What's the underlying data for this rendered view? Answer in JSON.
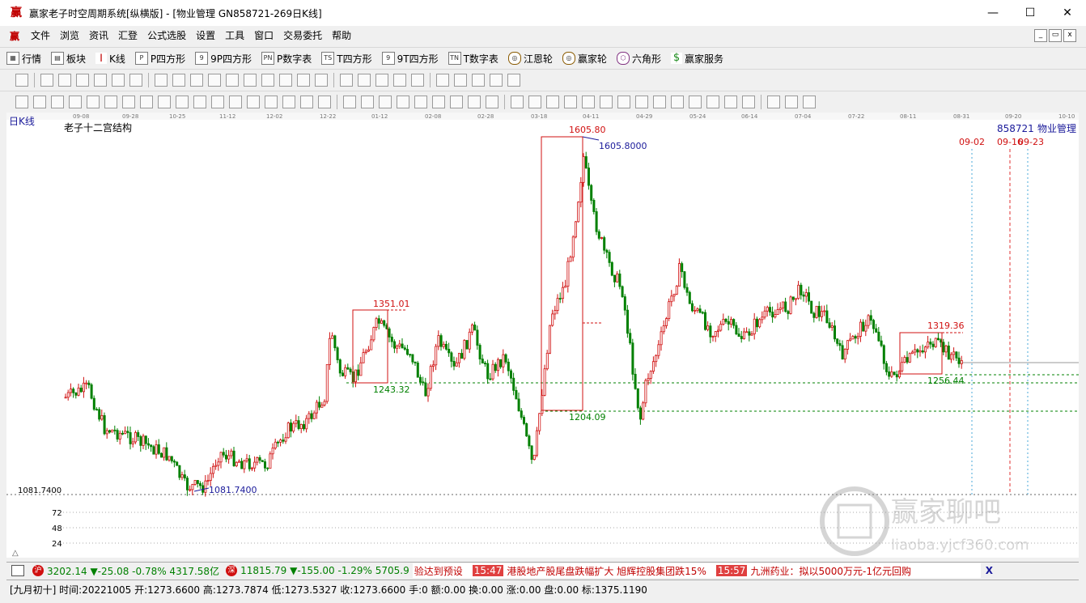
{
  "window": {
    "app_glyph": "赢",
    "title": "赢家老子时空周期系统[纵横版] - [物业管理   GN858721-269日K线]",
    "min": "—",
    "max": "☐",
    "close": "✕"
  },
  "menu": {
    "items": [
      "文件",
      "浏览",
      "资讯",
      "汇登",
      "公式选股",
      "设置",
      "工具",
      "窗口",
      "交易委托",
      "帮助"
    ]
  },
  "toolbar1": {
    "items": [
      {
        "icon": "table-icon",
        "label": "行情"
      },
      {
        "icon": "blocks-icon",
        "label": "板块"
      },
      {
        "icon": "kline-icon",
        "label": "K线"
      },
      {
        "icon": "P",
        "label": "P四方形"
      },
      {
        "icon": "9",
        "label": "9P四方形"
      },
      {
        "icon": "PN",
        "label": "P数字表"
      },
      {
        "icon": "TS",
        "label": "T四方形"
      },
      {
        "icon": "9T",
        "label": "9T四方形"
      },
      {
        "icon": "TN",
        "label": "T数字表"
      },
      {
        "icon": "wheel-icon",
        "label": "江恩轮"
      },
      {
        "icon": "wheel-icon",
        "label": "赢家轮"
      },
      {
        "icon": "hexagon-icon",
        "label": "六角形"
      },
      {
        "icon": "dollar-icon",
        "label": "赢家服务"
      }
    ]
  },
  "chart": {
    "period_label": "日K线",
    "indicator_label": "老子十二宫结构",
    "stock_code": "858721",
    "stock_name": "物业管理",
    "date_ticks": [
      "09-08",
      "09-28",
      "10-25",
      "11-12",
      "12-02",
      "12-22",
      "01-12",
      "02-08",
      "02-28",
      "03-18",
      "04-11",
      "04-29",
      "05-24",
      "06-14",
      "07-04",
      "07-22",
      "08-11",
      "08-31",
      "09-20",
      "10-10"
    ],
    "future_dates": [
      "09-02",
      "09-16",
      "09-23"
    ],
    "annotations": {
      "high_main": "1605.80",
      "high_precise": "1605.8000",
      "low_main": "1204.09",
      "box1_high": "1351.01",
      "box1_low": "1243.32",
      "box2_high": "1319.36",
      "box2_low": "1256.44",
      "low_precise": "1081.7400",
      "axis_low": "1081.7400"
    },
    "volume_ticks": [
      "72",
      "48",
      "24"
    ],
    "watermark_title": "赢家聊吧",
    "watermark_url": "liaoba.yjcf360.com",
    "corner_glyph": "△",
    "colors": {
      "up": "#d01010",
      "down": "#008000",
      "dash_green": "#008000",
      "blue": "#1a1a9a",
      "red_line": "#e03030"
    }
  },
  "status": {
    "index1_icon": "沪",
    "index1": "3202.14 ▼-25.08 -0.78% 4317.58亿",
    "index2_icon": "深",
    "index2": "11815.79 ▼-155.00 -1.29% 5705.9",
    "news_lead": "验达到预设",
    "news": [
      {
        "time": "15:47",
        "text": "港股地产股尾盘跌幅扩大 旭辉控股集团跌15%"
      },
      {
        "time": "15:57",
        "text": "九洲药业：拟以5000万元-1亿元回购"
      }
    ],
    "end_icon": "X"
  },
  "quote_line": "[九月初十] 时间:20221005 开:1273.6600 高:1273.7874 低:1273.5327 收:1273.6600 手:0 额:0.00 换:0.00 涨:0.00 盘:0.00 标:1375.1190"
}
